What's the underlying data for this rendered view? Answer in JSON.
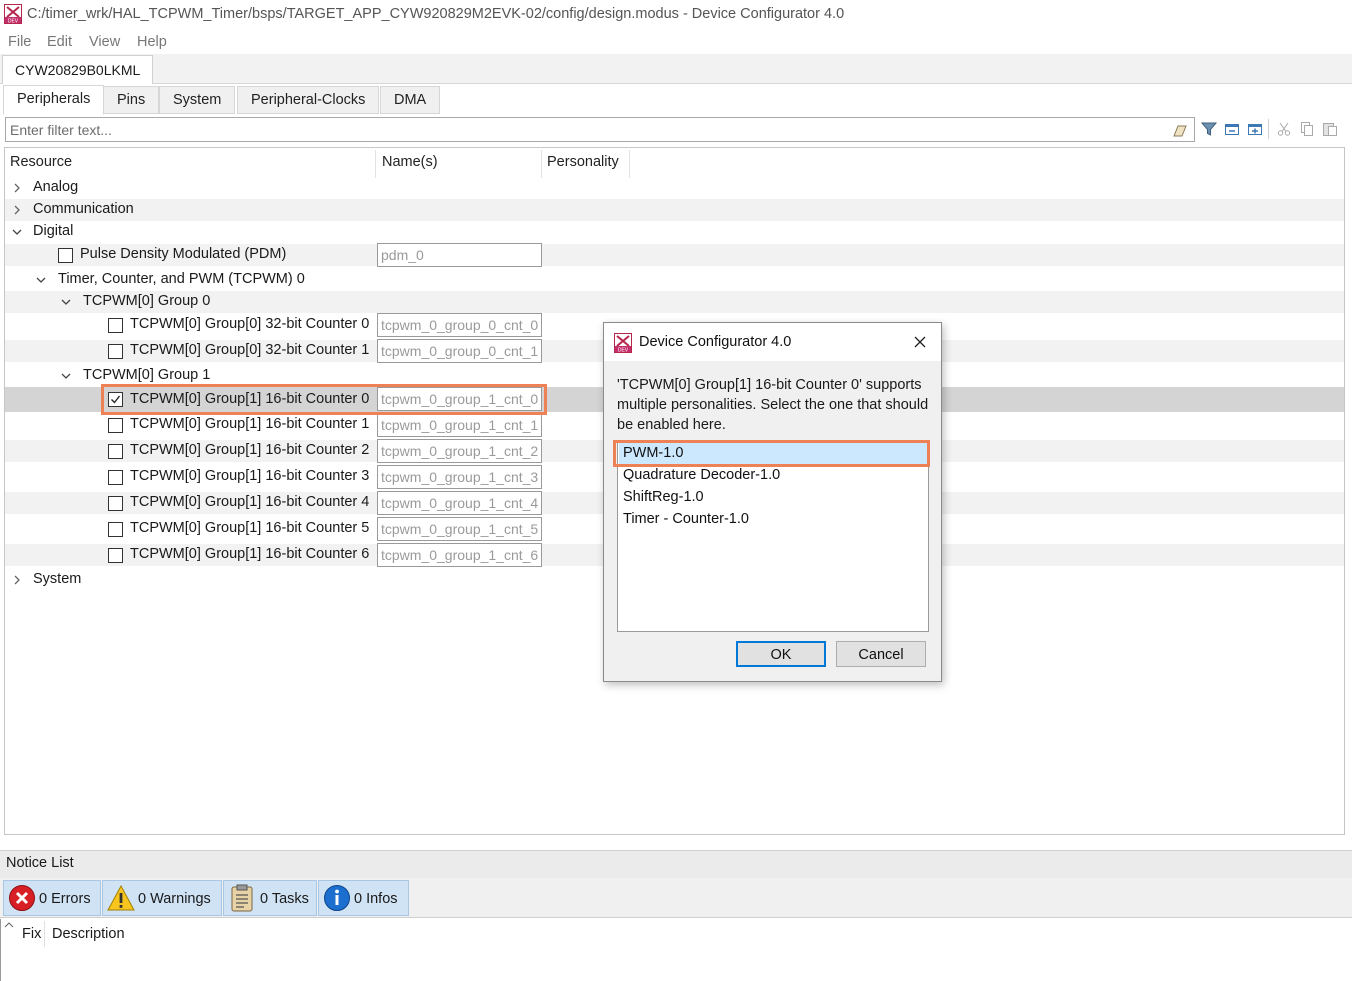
{
  "window": {
    "title": "C:/timer_wrk/HAL_TCPWM_Timer/bsps/TARGET_APP_CYW920829M2EVK-02/config/design.modus - Device Configurator 4.0",
    "icon": "device-configurator-app-icon"
  },
  "menu": [
    "File",
    "Edit",
    "View",
    "Help"
  ],
  "device_tab": "CYW20829B0LKML",
  "tabs": [
    "Peripherals",
    "Pins",
    "System",
    "Peripheral-Clocks",
    "DMA"
  ],
  "active_tab": "Peripherals",
  "filter": {
    "placeholder": "Enter filter text...",
    "value": ""
  },
  "toolbar_icons": [
    "eraser-icon",
    "filter-icon",
    "collapse-all-icon",
    "expand-all-icon",
    "cut-icon",
    "copy-icon",
    "paste-icon"
  ],
  "tree": {
    "headers": {
      "resource": "Resource",
      "names": "Name(s)",
      "personality": "Personality"
    },
    "rows": [
      {
        "label": "Analog",
        "expander": "collapsed"
      },
      {
        "label": "Communication",
        "expander": "collapsed"
      },
      {
        "label": "Digital",
        "expander": "expanded"
      },
      {
        "label": "Pulse Density Modulated (PDM)",
        "checkbox": false,
        "name": "pdm_0"
      },
      {
        "label": "Timer, Counter, and PWM (TCPWM) 0",
        "expander": "expanded"
      },
      {
        "label": "TCPWM[0] Group 0",
        "expander": "expanded"
      },
      {
        "label": "TCPWM[0] Group[0] 32-bit Counter 0",
        "checkbox": false,
        "name": "tcpwm_0_group_0_cnt_0"
      },
      {
        "label": "TCPWM[0] Group[0] 32-bit Counter 1",
        "checkbox": false,
        "name": "tcpwm_0_group_0_cnt_1"
      },
      {
        "label": "TCPWM[0] Group 1",
        "expander": "expanded"
      },
      {
        "label": "TCPWM[0] Group[1] 16-bit Counter 0",
        "checkbox": true,
        "name": "tcpwm_0_group_1_cnt_0",
        "selected": true
      },
      {
        "label": "TCPWM[0] Group[1] 16-bit Counter 1",
        "checkbox": false,
        "name": "tcpwm_0_group_1_cnt_1"
      },
      {
        "label": "TCPWM[0] Group[1] 16-bit Counter 2",
        "checkbox": false,
        "name": "tcpwm_0_group_1_cnt_2"
      },
      {
        "label": "TCPWM[0] Group[1] 16-bit Counter 3",
        "checkbox": false,
        "name": "tcpwm_0_group_1_cnt_3"
      },
      {
        "label": "TCPWM[0] Group[1] 16-bit Counter 4",
        "checkbox": false,
        "name": "tcpwm_0_group_1_cnt_4"
      },
      {
        "label": "TCPWM[0] Group[1] 16-bit Counter 5",
        "checkbox": false,
        "name": "tcpwm_0_group_1_cnt_5"
      },
      {
        "label": "TCPWM[0] Group[1] 16-bit Counter 6",
        "checkbox": false,
        "name": "tcpwm_0_group_1_cnt_6"
      },
      {
        "label": "System",
        "expander": "collapsed"
      }
    ]
  },
  "notice": {
    "title": "Notice List",
    "errors": "0 Errors",
    "warnings": "0 Warnings",
    "tasks": "0 Tasks",
    "infos": "0 Infos",
    "columns": {
      "fix": "Fix",
      "description": "Description"
    }
  },
  "dialog": {
    "title": "Device Configurator 4.0",
    "message": "'TCPWM[0] Group[1] 16-bit Counter 0' supports multiple personalities. Select the one that should be enabled here.",
    "options": [
      "PWM-1.0",
      "Quadrature Decoder-1.0",
      "ShiftReg-1.0",
      "Timer - Counter-1.0"
    ],
    "selected_option": "PWM-1.0",
    "ok": "OK",
    "cancel": "Cancel"
  },
  "colors": {
    "highlight": "#ef8156",
    "selection": "#cce8ff",
    "notice_button": "#cfe3f5"
  }
}
